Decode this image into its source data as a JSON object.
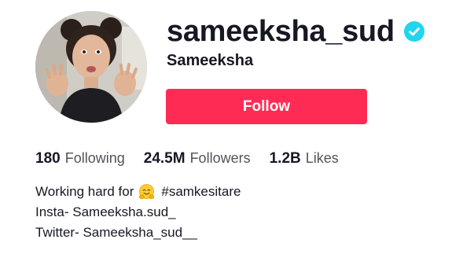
{
  "profile": {
    "username": "sameeksha_sud",
    "display_name": "Sameeksha",
    "verified": true,
    "verified_icon": "verified-check-icon",
    "accent_color": "#fe2c55",
    "verified_color": "#20d5ec"
  },
  "actions": {
    "follow_label": "Follow"
  },
  "stats": {
    "following": {
      "count": "180",
      "label": "Following"
    },
    "followers": {
      "count": "24.5M",
      "label": "Followers"
    },
    "likes": {
      "count": "1.2B",
      "label": "Likes"
    }
  },
  "bio": {
    "line1_prefix": "Working hard for",
    "line1_emoji": "hugging-face-emoji-icon",
    "line1_suffix": "#samkesitare",
    "line2": "Insta- Sameeksha.sud_",
    "line3": "Twitter- Sameeksha_sud__"
  }
}
